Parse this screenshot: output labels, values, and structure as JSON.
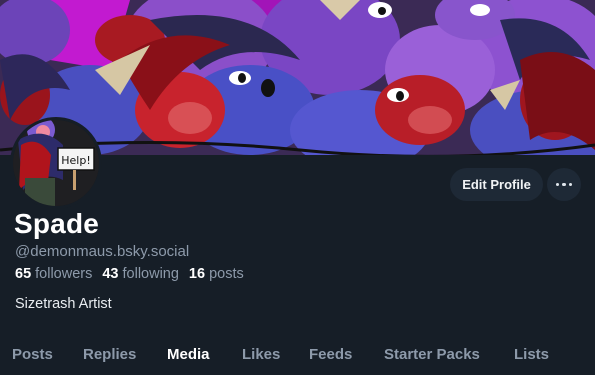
{
  "profile": {
    "display_name": "Spade",
    "handle": "@demonmaus.bsky.social",
    "bio": "Sizetrash Artist",
    "avatar_sign_text": "Help!"
  },
  "stats": {
    "followers_count": "65",
    "followers_label": "followers",
    "following_count": "43",
    "following_label": "following",
    "posts_count": "16",
    "posts_label": "posts"
  },
  "actions": {
    "edit_profile_label": "Edit Profile",
    "more_icon": "ellipsis-icon"
  },
  "tabs": [
    {
      "label": "Posts",
      "active": false
    },
    {
      "label": "Replies",
      "active": false
    },
    {
      "label": "Media",
      "active": true
    },
    {
      "label": "Likes",
      "active": false
    },
    {
      "label": "Feeds",
      "active": false
    },
    {
      "label": "Starter Packs",
      "active": false
    },
    {
      "label": "Lists",
      "active": false
    }
  ],
  "colors": {
    "background": "#161e27",
    "button_bg": "#1e2936",
    "muted_text": "#8d9aaa",
    "banner_purple": "#8b4fc9",
    "banner_blue": "#4a4fc0",
    "banner_red": "#b01822"
  }
}
